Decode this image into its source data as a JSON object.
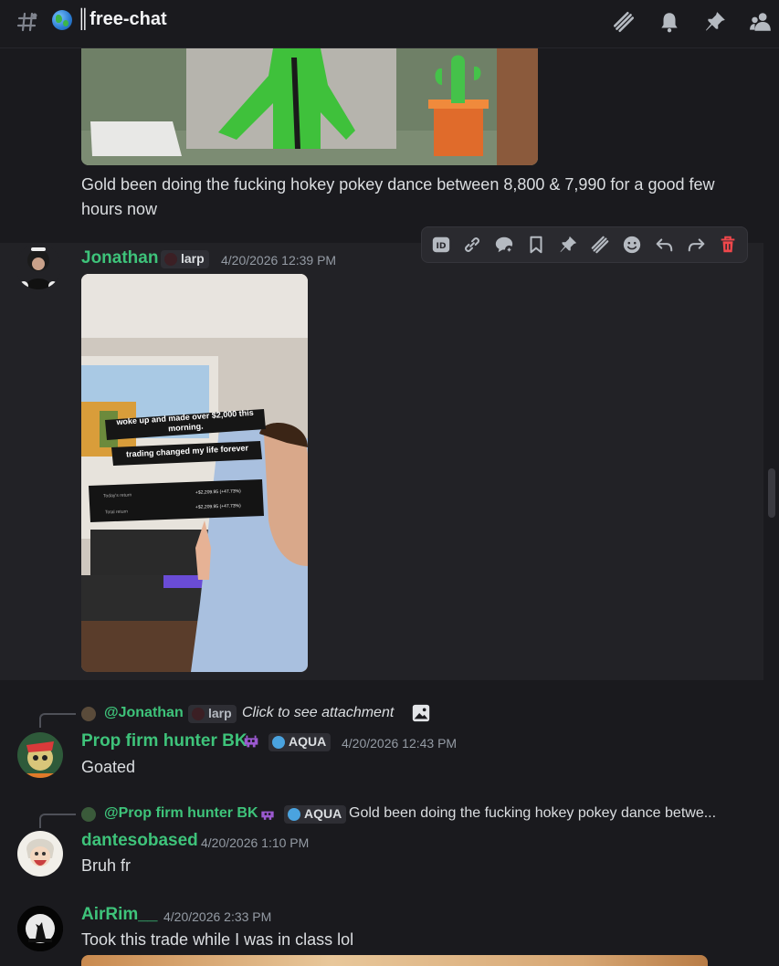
{
  "header": {
    "channel_name": "║free-chat",
    "icons": [
      "hashtag-icon",
      "globe-icon",
      "threads-icon",
      "bell-icon",
      "pin-icon",
      "members-icon"
    ]
  },
  "messages": [
    {
      "text": "Gold been doing the fucking hokey pokey dance between 8,800 & 7,990 for a good few hours now"
    },
    {
      "username": "Jonathan",
      "tag": "larp",
      "timestamp": "4/20/2026 12:39 PM",
      "attachment": {
        "caption_line1": "woke up and made over $2,000 this",
        "caption_line2": "morning.",
        "caption_line3": "trading changed my life forever",
        "row1_label": "Today's return",
        "row1_value": "+$2,209.95 (+47.73%)",
        "row2_label": "Total return",
        "row2_value": "+$2,209.95 (+47.73%)"
      }
    },
    {
      "reply_to": "@Jonathan",
      "reply_tag": "larp",
      "reply_text": "Click to see attachment",
      "username": "Prop firm hunter BK",
      "tag": "AQUA",
      "timestamp": "4/20/2026 12:43 PM",
      "text": "Goated"
    },
    {
      "reply_to": "@Prop firm hunter BK",
      "reply_tag": "AQUA",
      "reply_text": "Gold been doing the fucking hokey pokey dance betwe...",
      "username": "dantesobased",
      "timestamp": "4/20/2026 1:10 PM",
      "text": "Bruh fr"
    },
    {
      "username": "AirRim__",
      "timestamp": "4/20/2026 2:33 PM",
      "text": "Took this trade while I was in class lol"
    }
  ],
  "toolbar": [
    "id-icon",
    "link-icon",
    "thread-icon",
    "bookmark-icon",
    "pin-icon",
    "threads-icon",
    "emoji-icon",
    "reply-icon",
    "forward-icon",
    "delete-icon"
  ],
  "colors": {
    "background": "#1a1a1e",
    "username_green": "#3ec37a",
    "text": "#dbdee1",
    "muted": "#949ba4",
    "delete_red": "#f0474b"
  }
}
